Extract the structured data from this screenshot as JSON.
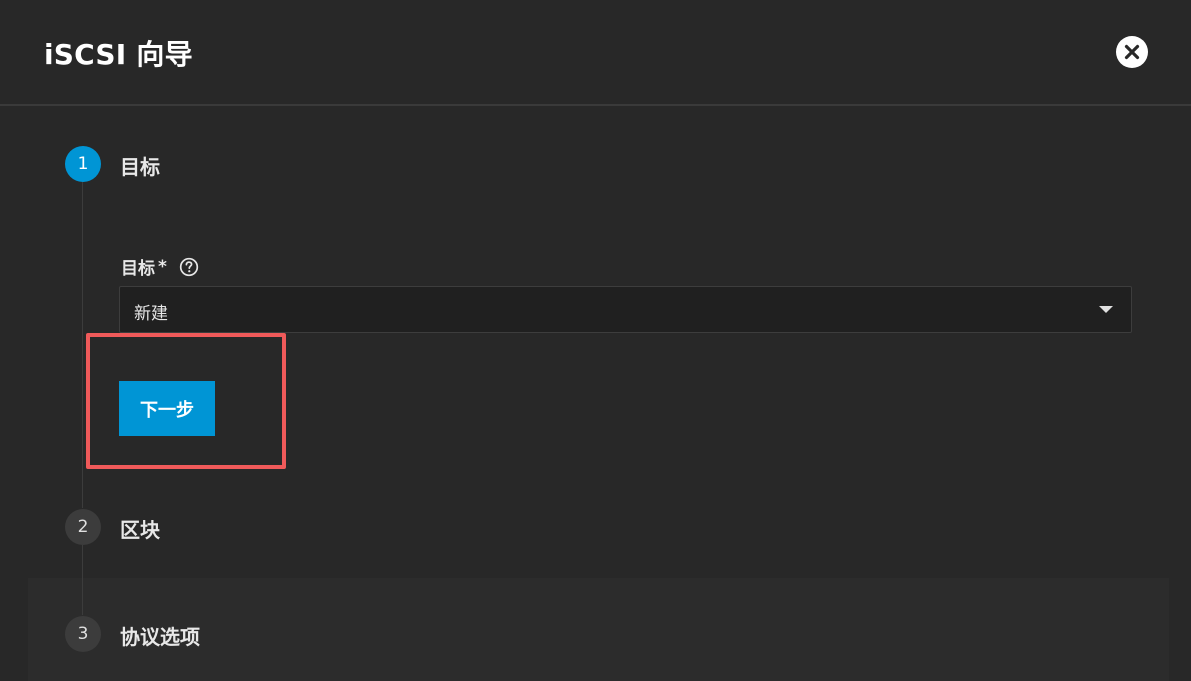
{
  "header": {
    "title": "iSCSI 向导",
    "close_icon": "close-icon"
  },
  "steps": [
    {
      "number": "1",
      "label": "目标",
      "state": "active"
    },
    {
      "number": "2",
      "label": "区块",
      "state": "inactive"
    },
    {
      "number": "3",
      "label": "协议选项",
      "state": "inactive"
    }
  ],
  "form": {
    "target_label": "目标",
    "required_mark": "*",
    "help_icon": "help-circle-icon",
    "target_value": "新建",
    "dropdown_icon": "chevron-down-icon",
    "next_label": "下一步"
  },
  "colors": {
    "accent": "#0095d5",
    "highlight": "#f05a5a",
    "background": "#282828"
  }
}
